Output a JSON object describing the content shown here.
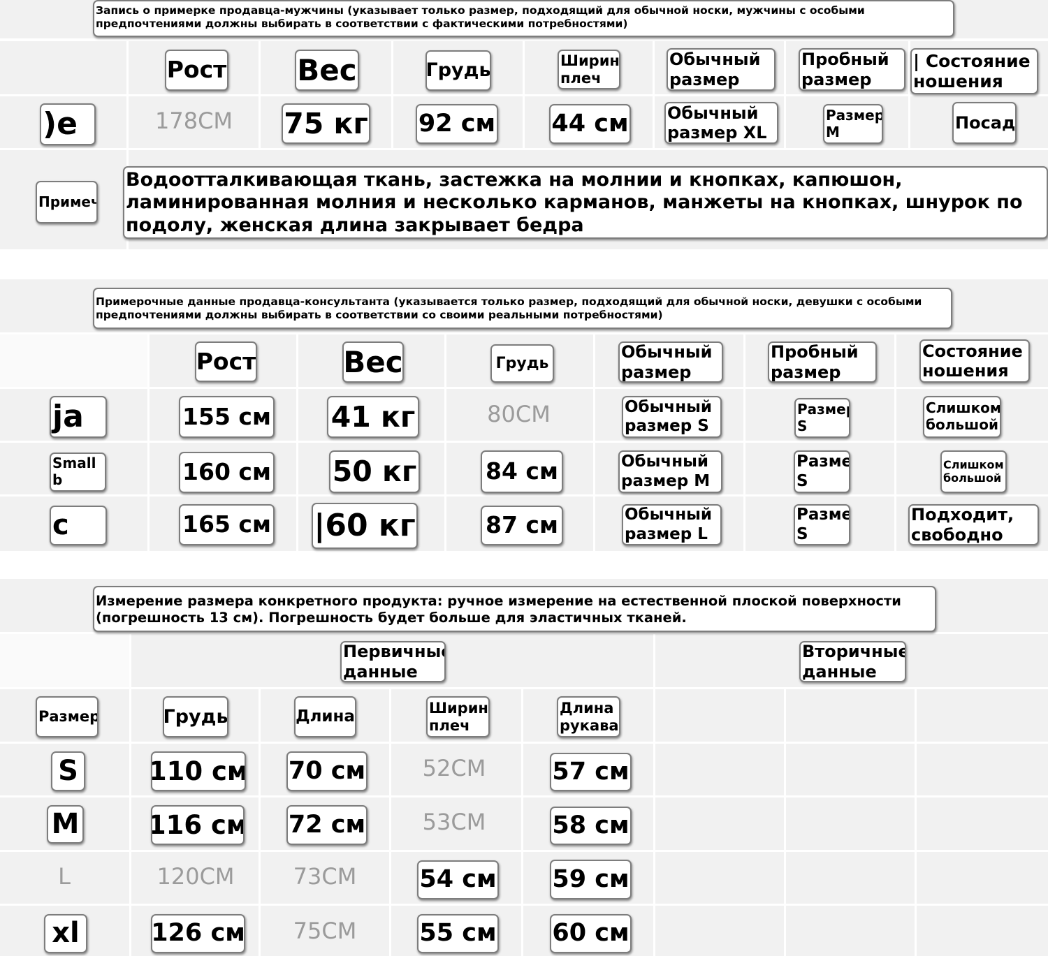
{
  "section1": {
    "caption": "Запись о примерке продавца-мужчины (указывает только размер, подходящий для обычной носки, мужчины с особыми предпочтениями должны выбирать в соответствии с фактическими потребностями)",
    "headers": {
      "height": "Рост",
      "weight": "Вес",
      "chest": "Грудь",
      "shoulder": "Ширина плеч",
      "usual_size": "Обычный размер",
      "trial_size": "Пробный размер",
      "wear_state": "| Состояние ношения"
    },
    "row": {
      "name": ")e",
      "height": "178CM",
      "weight": "75 кг",
      "chest": "92 см",
      "shoulder": "44 см",
      "usual_size": "Обычный размер XL",
      "trial_size": "Размер М",
      "wear_state": "Посадка"
    },
    "notes_label": "Примечания",
    "notes_text": "Водоотталкивающая ткань, застежка на молнии и кнопках, капюшон, ламинированная молния и несколько карманов, манжеты на кнопках, шнурок по подолу, женская длина закрывает бедра"
  },
  "section2": {
    "caption": "Примерочные данные продавца-консультанта (указывается только размер, подходящий для обычной носки, девушки с особыми предпочтениями должны выбирать в соответствии со своими реальными потребностями)",
    "headers": {
      "height": "Рост",
      "weight": "Вес",
      "chest": "Грудь",
      "usual_size": "Обычный размер",
      "trial_size": "Пробный размер",
      "wear_state": "Состояние ношения"
    },
    "rows": [
      {
        "name": "ja",
        "height": "155 см",
        "weight": "41 кг",
        "chest": "80CM",
        "usual_size": "Обычный размер S",
        "trial_size": "Размер S",
        "wear_state": "Слишком большой"
      },
      {
        "name": "Small b",
        "height": "160 см",
        "weight": "50 кг",
        "chest": "84 см",
        "usual_size": "Обычный размер М",
        "trial_size": "Размер S",
        "wear_state": "Слишком большой"
      },
      {
        "name": "c",
        "height": "165 см",
        "weight": "|60 кг",
        "chest": "87 см",
        "usual_size": "Обычный размер L",
        "trial_size": "Размер S",
        "wear_state": "Подходит, свободно"
      }
    ]
  },
  "section3": {
    "caption": "Измерение размера конкретного продукта: ручное измерение на естественной плоской поверхности (погрешность 13 см). Погрешность будет больше для эластичных тканей.",
    "group_primary": "Первичные данные",
    "group_secondary": "Вторичные данные",
    "headers": {
      "size": "Размер",
      "chest": "Грудь",
      "length": "Длина",
      "shoulder": "Ширина плеч",
      "sleeve": "Длина рукава"
    },
    "rows": [
      {
        "size": "S",
        "chest": "110 см",
        "length": "70 см",
        "shoulder": "52CM",
        "sleeve": "57 см"
      },
      {
        "size": "M",
        "chest": "116 см",
        "length": "72 см",
        "shoulder": "53CM",
        "sleeve": "58 см"
      },
      {
        "size": "L",
        "chest": "120CM",
        "length": "73CM",
        "shoulder": "54 см",
        "sleeve": "59 см"
      },
      {
        "size": "xl",
        "chest": "126 см",
        "length": "75CM",
        "shoulder": "55 см",
        "sleeve": "60 см"
      }
    ]
  }
}
